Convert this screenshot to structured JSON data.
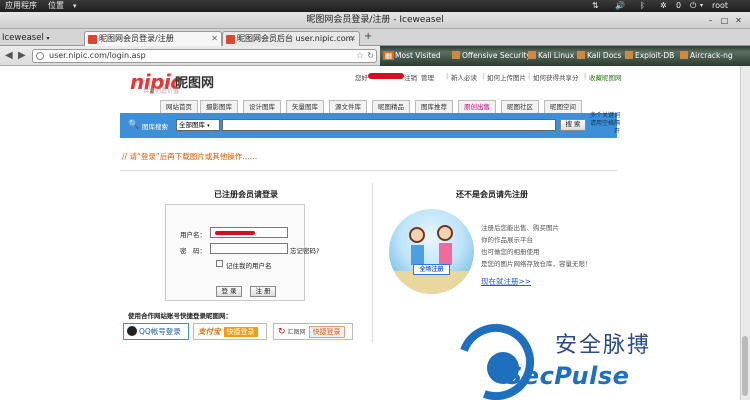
{
  "panel": {
    "apps": "应用程序",
    "places": "位置",
    "user": "root",
    "time": "0"
  },
  "window": {
    "title": "昵图网会员登录/注册 - Iceweasel"
  },
  "browser": {
    "app_menu": "Iceweasel",
    "tabs": [
      {
        "label": "昵图网会员登录/注册"
      },
      {
        "label": "昵图网会员后台 user.nipic.com"
      }
    ],
    "url": "user.nipic.com/login.asp",
    "bookmarks": [
      "Most Visited",
      "Offensive Security",
      "Kali Linux",
      "Kali Docs",
      "Exploit-DB",
      "Aircrack-ng"
    ]
  },
  "site": {
    "logo": "nipic",
    "logo_cn": "昵图网",
    "tagline": "共享创造价值",
    "greeting": "您好",
    "nick_mask": "",
    "logout": "注销",
    "manage": "管理",
    "links": [
      "新人必读",
      "如何上传图片",
      "如何获得共享分",
      "收藏昵图网"
    ],
    "nav": [
      "网站首页",
      "摄影图库",
      "设计图库",
      "矢量图库",
      "源文件库",
      "昵图精品",
      "图库推荐",
      "原创出售",
      "昵图社区",
      "昵图空间"
    ],
    "search_label": "图库搜索",
    "search_scope": "全部图库",
    "search_btn": "搜 索",
    "search_more": "多个关键词请用空格隔开",
    "hint": "// 请“登录”后再下载图片或其他操作……",
    "login": {
      "heading": "已注册会员请登录",
      "user_label": "用户名：",
      "pass_label": "密　码：",
      "forgot": "忘记密码?",
      "remember": "记住我的用户名",
      "login_btn": "登 录",
      "register_btn": "注 册"
    },
    "register": {
      "heading": "还不是会员请先注册",
      "lines": [
        "注册后您能出售、购买图片",
        "你的作品展示平台",
        "也可做您的相册使用",
        "是您的图片网络存放仓库，容量无限！"
      ],
      "link": "现在就注册>>",
      "badge": "全场注册"
    },
    "partner": {
      "heading": "使用合作网站账号快捷登录昵图网：",
      "qq": "QQ帐号登录",
      "alipay": "支付宝",
      "fast": "快捷登录",
      "huitu": "汇图网",
      "huitu_fast": "快捷登录"
    }
  },
  "watermark": {
    "cn": "安全脉搏",
    "en": "SecPulse"
  }
}
